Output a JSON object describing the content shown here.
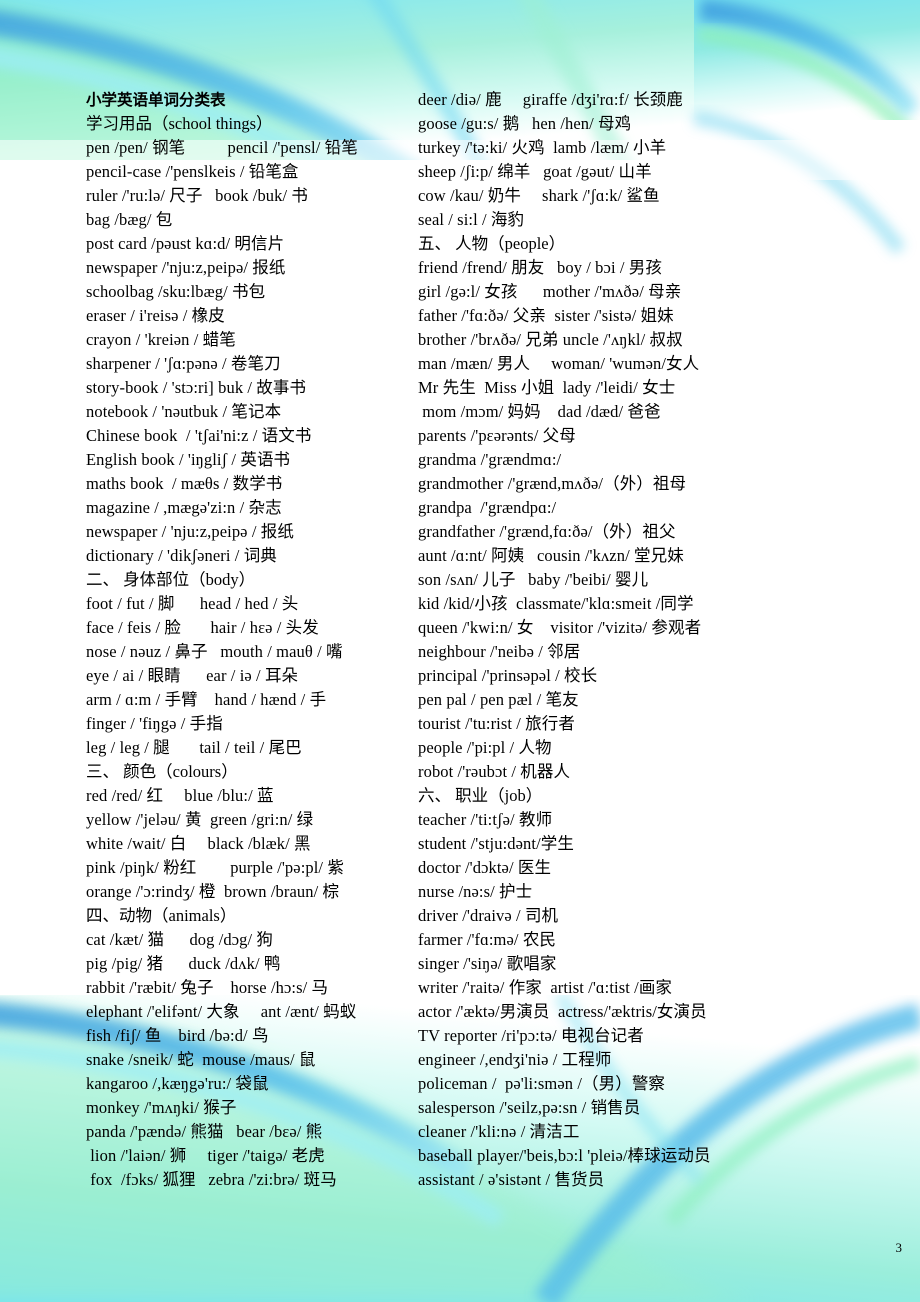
{
  "document": {
    "title": "小学英语单词分类表",
    "page_number": "3",
    "colors": {
      "cyan": "#7fe6f2",
      "green_tint": "#9ef0c8",
      "blue_arc": "#49b6e8",
      "deep_blue": "#3f9fe0",
      "text": "#000000"
    }
  },
  "left_column": [
    {
      "type": "section",
      "text": "学习用品（school things）"
    },
    {
      "type": "entry",
      "text": "pen /pen/ 钢笔          pencil /'pensl/ 铅笔"
    },
    {
      "type": "entry",
      "text": "pencil-case /'penslkeis / 铅笔盒"
    },
    {
      "type": "entry",
      "text": "ruler /'ru:lə/ 尺子   book /buk/ 书"
    },
    {
      "type": "entry",
      "text": "bag /bæg/ 包"
    },
    {
      "type": "entry",
      "text": "post card /pəust kɑ:d/ 明信片"
    },
    {
      "type": "entry",
      "text": "newspaper /'nju:z,peipə/ 报纸"
    },
    {
      "type": "entry",
      "text": "schoolbag /sku:lbæg/ 书包"
    },
    {
      "type": "entry",
      "text": "eraser / i'reisə / 橡皮"
    },
    {
      "type": "entry",
      "text": "crayon / 'kreiən / 蜡笔"
    },
    {
      "type": "entry",
      "text": "sharpener / 'ʃɑ:pənə / 卷笔刀"
    },
    {
      "type": "entry",
      "text": "story-book / 'stɔ:ri] buk / 故事书"
    },
    {
      "type": "entry",
      "text": "notebook / 'nəutbuk / 笔记本"
    },
    {
      "type": "entry",
      "text": "Chinese book  / 'tʃai'ni:z / 语文书"
    },
    {
      "type": "entry",
      "text": "English book / 'iŋgliʃ / 英语书"
    },
    {
      "type": "entry",
      "text": "maths book  / mæθs / 数学书"
    },
    {
      "type": "entry",
      "text": "magazine / ,mægə'zi:n / 杂志"
    },
    {
      "type": "entry",
      "text": "newspaper / 'nju:z,peipə / 报纸"
    },
    {
      "type": "entry",
      "text": "dictionary / 'dikʃəneri / 词典"
    },
    {
      "type": "section",
      "text": "二、 身体部位（body）"
    },
    {
      "type": "entry",
      "text": "foot / fut / 脚      head / hed / 头"
    },
    {
      "type": "entry",
      "text": "face / feis / 脸       hair / hɛə / 头发"
    },
    {
      "type": "entry",
      "text": "nose / nəuz / 鼻子   mouth / mauθ / 嘴"
    },
    {
      "type": "entry",
      "text": "eye / ai / 眼睛      ear / iə / 耳朵"
    },
    {
      "type": "entry",
      "text": "arm / ɑ:m / 手臂    hand / hænd / 手"
    },
    {
      "type": "entry",
      "text": "finger / 'fiŋgə / 手指"
    },
    {
      "type": "entry",
      "text": "leg / leg / 腿       tail / teil / 尾巴"
    },
    {
      "type": "section",
      "text": "三、 颜色（colours）"
    },
    {
      "type": "entry",
      "text": "red /red/ 红     blue /blu:/ 蓝"
    },
    {
      "type": "entry",
      "text": "yellow /'jeləu/ 黄  green /gri:n/ 绿"
    },
    {
      "type": "entry",
      "text": "white /wait/ 白     black /blæk/ 黑"
    },
    {
      "type": "entry",
      "text": "pink /piŋk/ 粉红        purple /'pə:pl/ 紫"
    },
    {
      "type": "entry",
      "text": "orange /'ɔ:rindʒ/ 橙  brown /braun/ 棕"
    },
    {
      "type": "section",
      "text": "四、动物（animals）"
    },
    {
      "type": "entry",
      "text": "cat /kæt/ 猫      dog /dɔg/ 狗"
    },
    {
      "type": "entry",
      "text": "pig /pig/ 猪      duck /dʌk/ 鸭"
    },
    {
      "type": "entry",
      "text": "rabbit /'ræbit/ 兔子    horse /hɔ:s/ 马"
    },
    {
      "type": "entry",
      "text": "elephant /'elifənt/ 大象     ant /ænt/ 蚂蚁"
    },
    {
      "type": "entry",
      "text": "fish /fiʃ/ 鱼    bird /bə:d/ 鸟"
    },
    {
      "type": "entry",
      "text": "snake /sneik/ 蛇  mouse /maus/ 鼠"
    },
    {
      "type": "entry",
      "text": "kangaroo /,kæŋgə'ru:/ 袋鼠"
    },
    {
      "type": "entry",
      "text": "monkey /'mʌŋki/ 猴子"
    },
    {
      "type": "entry",
      "text": "panda /'pændə/ 熊猫   bear /bɛə/ 熊"
    },
    {
      "type": "entry",
      "text": " lion /'laiən/ 狮     tiger /'taigə/ 老虎"
    },
    {
      "type": "entry",
      "text": " fox  /fɔks/ 狐狸   zebra /'zi:brə/ 斑马"
    }
  ],
  "right_column": [
    {
      "type": "entry",
      "text": "deer /diə/ 鹿     giraffe /dʒi'rɑ:f/ 长颈鹿"
    },
    {
      "type": "entry",
      "text": "goose /gu:s/ 鹅   hen /hen/ 母鸡"
    },
    {
      "type": "entry",
      "text": "turkey /'tə:ki/ 火鸡  lamb /læm/ 小羊"
    },
    {
      "type": "entry",
      "text": "sheep /ʃi:p/ 绵羊   goat /gəut/ 山羊"
    },
    {
      "type": "entry",
      "text": "cow /kau/ 奶牛     shark /'ʃɑ:k/ 鲨鱼"
    },
    {
      "type": "entry",
      "text": "seal / si:l / 海豹"
    },
    {
      "type": "section",
      "text": "五、 人物（people）"
    },
    {
      "type": "entry",
      "text": "friend /frend/ 朋友   boy / bɔi / 男孩"
    },
    {
      "type": "entry",
      "text": "girl /gə:l/ 女孩      mother /'mʌðə/ 母亲"
    },
    {
      "type": "entry",
      "text": "father /'fɑ:ðə/ 父亲  sister /'sistə/ 姐妹"
    },
    {
      "type": "entry",
      "text": "brother /'brʌðə/ 兄弟 uncle /'ʌŋkl/ 叔叔"
    },
    {
      "type": "entry",
      "text": "man /mæn/ 男人     woman/ 'wumən/女人"
    },
    {
      "type": "entry",
      "text": "Mr 先生  Miss 小姐  lady /'leidi/ 女士"
    },
    {
      "type": "entry",
      "text": " mom /mɔm/ 妈妈    dad /dæd/ 爸爸"
    },
    {
      "type": "entry",
      "text": "parents /'pɛərənts/ 父母"
    },
    {
      "type": "entry",
      "text": "grandma /'grændmɑ:/"
    },
    {
      "type": "entry",
      "text": "grandmother /'grænd,mʌðə/（外）祖母"
    },
    {
      "type": "entry",
      "text": "grandpa  /'grændpɑ:/"
    },
    {
      "type": "entry",
      "text": "grandfather /'grænd,fɑ:ðə/（外）祖父"
    },
    {
      "type": "entry",
      "text": "aunt /ɑ:nt/ 阿姨   cousin /'kʌzn/ 堂兄妹"
    },
    {
      "type": "entry",
      "text": "son /sʌn/ 儿子   baby /'beibi/ 婴儿"
    },
    {
      "type": "entry",
      "text": "kid /kid/小孩  classmate/'klɑ:smeit /同学"
    },
    {
      "type": "entry",
      "text": "queen /'kwi:n/ 女    visitor /'vizitə/ 参观者"
    },
    {
      "type": "entry",
      "text": "neighbour /'neibə / 邻居"
    },
    {
      "type": "entry",
      "text": "principal /'prinsəpəl / 校长"
    },
    {
      "type": "entry",
      "text": "pen pal / pen pæl / 笔友"
    },
    {
      "type": "entry",
      "text": "tourist /'tu:rist / 旅行者"
    },
    {
      "type": "entry",
      "text": "people /'pi:pl / 人物"
    },
    {
      "type": "entry",
      "text": "robot /'rəubɔt / 机器人"
    },
    {
      "type": "section",
      "text": "六、 职业（job）"
    },
    {
      "type": "entry",
      "text": "teacher /'ti:tʃə/ 教师"
    },
    {
      "type": "entry",
      "text": "student /'stju:dənt/学生"
    },
    {
      "type": "entry",
      "text": "doctor /'dɔktə/ 医生"
    },
    {
      "type": "entry",
      "text": "nurse /nə:s/ 护士"
    },
    {
      "type": "entry",
      "text": "driver /'draivə / 司机"
    },
    {
      "type": "entry",
      "text": "farmer /'fɑ:mə/ 农民"
    },
    {
      "type": "entry",
      "text": "singer /'siŋə/ 歌唱家"
    },
    {
      "type": "entry",
      "text": "writer /'raitə/ 作家  artist /'ɑ:tist /画家"
    },
    {
      "type": "entry",
      "text": "actor /'æktə/男演员  actress/'æktris/女演员"
    },
    {
      "type": "entry",
      "text": "TV reporter /ri'pɔ:tə/ 电视台记者"
    },
    {
      "type": "entry",
      "text": "engineer /,endʒi'niə / 工程师"
    },
    {
      "type": "entry",
      "text": "policeman /  pə'li:smən /（男）警察"
    },
    {
      "type": "entry",
      "text": "salesperson /'seilz,pə:sn / 销售员"
    },
    {
      "type": "entry",
      "text": "cleaner /'kli:nə / 清洁工"
    },
    {
      "type": "entry",
      "text": "baseball player/'beis,bɔ:l 'pleiə/棒球运动员"
    },
    {
      "type": "entry",
      "text": "assistant / ə'sistənt / 售货员"
    }
  ]
}
